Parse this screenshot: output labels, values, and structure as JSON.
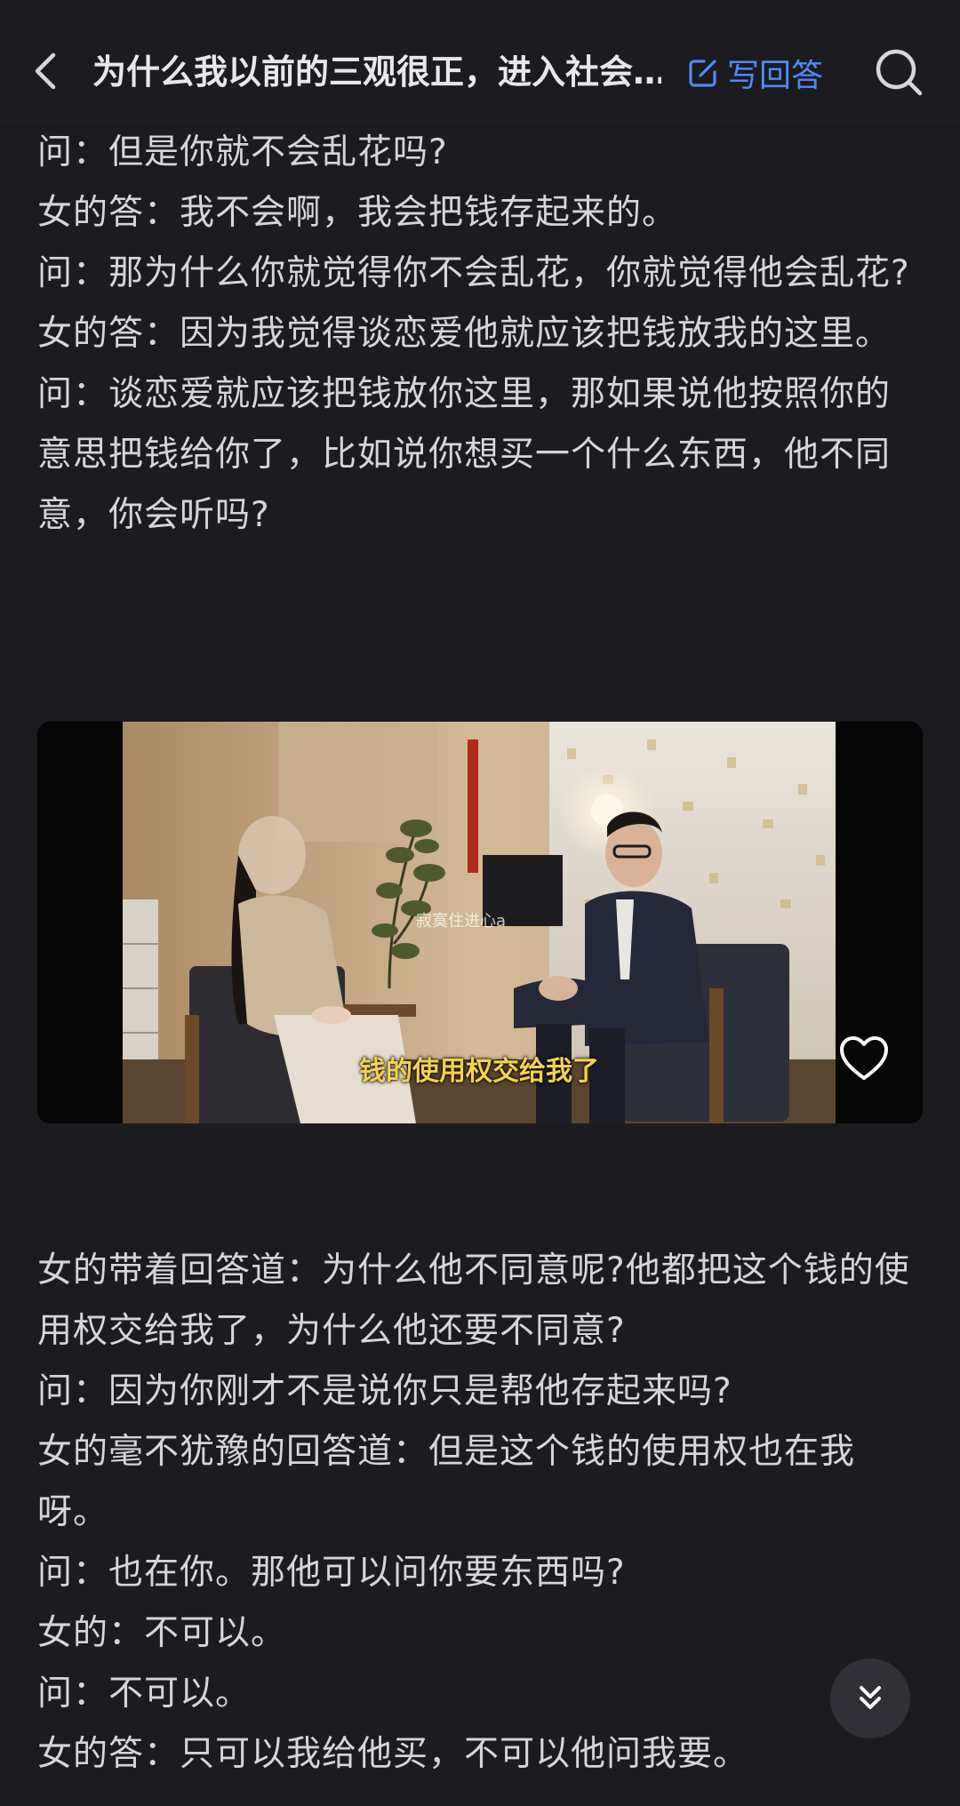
{
  "header": {
    "title": "为什么我以前的三观很正，进入社会…",
    "write_answer_label": "写回答",
    "accent_color": "#4f8bf0",
    "icons": {
      "back": "chevron-left-icon",
      "write": "edit-icon",
      "search": "search-icon"
    }
  },
  "answer": {
    "paragraphs_before_video": [
      "问：但是你就不会乱花吗?",
      "女的答：我不会啊，我会把钱存起来的。",
      "问：那为什么你就觉得你不会乱花，你就觉得他会乱花?",
      "女的答：因为我觉得谈恋爱他就应该把钱放我的这里。",
      "问：谈恋爱就应该把钱放你这里，那如果说他按照你的意思把钱给你了，比如说你想买一个什么东西，他不同意，你会听吗?"
    ],
    "video": {
      "caption": "钱的使用权交给我了",
      "watermark": "寂寞住进心a",
      "like_icon": "heart-icon"
    },
    "paragraphs_after_video": [
      "女的带着回答道：为什么他不同意呢?他都把这个钱的使用权交给我了，为什么他还要不同意?",
      "问：因为你刚才不是说你只是帮他存起来吗?",
      "女的毫不犹豫的回答道：但是这个钱的使用权也在我呀。",
      "问：也在你。那他可以问你要东西吗?",
      "女的：不可以。",
      "问：不可以。",
      "女的答：只可以我给他买，不可以他问我要。"
    ]
  },
  "floating": {
    "scroll_icon": "double-chevron-down-icon"
  },
  "theme": {
    "background": "#1b1b20",
    "text": "#d5d5da",
    "caption_color": "#f3d24c"
  }
}
